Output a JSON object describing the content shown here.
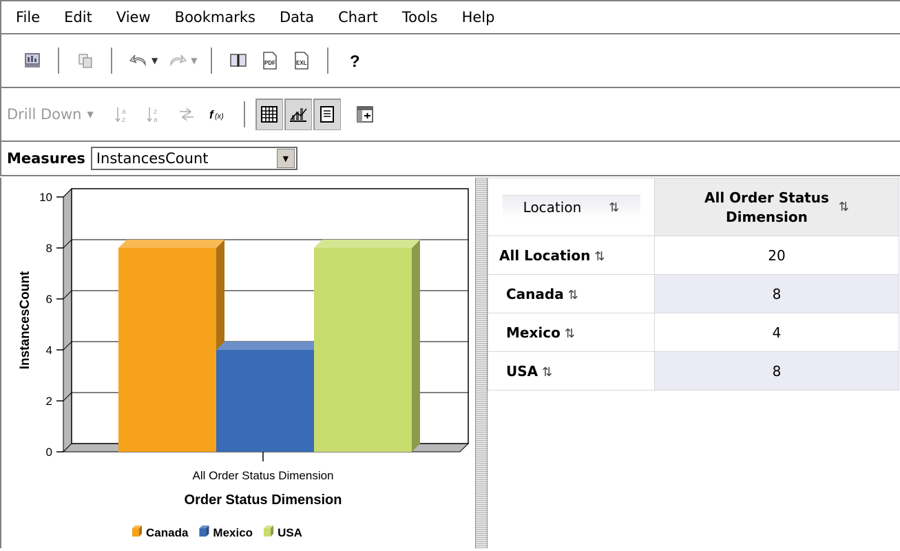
{
  "menu": [
    "File",
    "Edit",
    "View",
    "Bookmarks",
    "Data",
    "Chart",
    "Tools",
    "Help"
  ],
  "toolbar2": {
    "drill_label": "Drill Down"
  },
  "measures": {
    "label": "Measures",
    "selected": "InstancesCount"
  },
  "chart_data": {
    "type": "bar",
    "categories": [
      "All Order Status Dimension"
    ],
    "series": [
      {
        "name": "Canada",
        "values": [
          8
        ],
        "color": "#f7a21b"
      },
      {
        "name": "Mexico",
        "values": [
          4
        ],
        "color": "#3a6bb5"
      },
      {
        "name": "USA",
        "values": [
          8
        ],
        "color": "#c7dc6c"
      }
    ],
    "xlabel": "Order Status Dimension",
    "ylabel": "InstancesCount",
    "ylim": [
      0,
      10
    ],
    "yticks": [
      "0",
      "2",
      "4",
      "6",
      "8",
      "10"
    ],
    "grid": true,
    "legend": "bottom"
  },
  "table": {
    "row_header": "Location",
    "col_header_line1": "All Order Status",
    "col_header_line2": "Dimension",
    "sort_glyph": "⇅",
    "rows": [
      {
        "label": "All Location",
        "value": "20"
      },
      {
        "label": "Canada",
        "value": "8"
      },
      {
        "label": "Mexico",
        "value": "4"
      },
      {
        "label": "USA",
        "value": "8"
      }
    ]
  }
}
